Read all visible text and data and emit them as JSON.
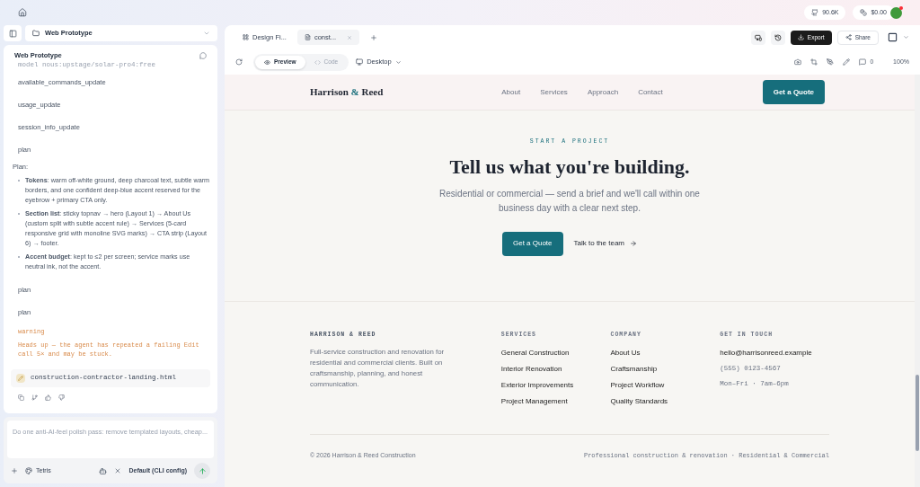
{
  "top_bar": {
    "stars": "90.6K",
    "cost": "$0.00"
  },
  "project": {
    "name": "Web Prototype"
  },
  "chat": {
    "title": "Web Prototype",
    "events": [
      {
        "kind": "mono",
        "text": "model nous:upstage/solar-pro4:free"
      },
      {
        "kind": "event",
        "text": "available_commands_update"
      },
      {
        "kind": "event",
        "text": "usage_update"
      },
      {
        "kind": "event",
        "text": "session_info_update"
      },
      {
        "kind": "event",
        "text": "plan"
      }
    ],
    "plan_heading": "Plan:",
    "plan_items": [
      {
        "text": "**Tokens**: warm off-white ground, deep charcoal text, subtle warm borders, and one confident deep-blue accent reserved for the eyebrow + primary CTA only."
      },
      {
        "text": "**Section list**: sticky topnav → hero (Layout 1) → About Us (custom split with subtle accent rule) → Services (5-card responsive grid with monoline SVG marks) → CTA strip (Layout 6) → footer."
      },
      {
        "text": "**Accent budget**: kept to ≤2 per screen; service marks use neutral ink, not the accent."
      }
    ],
    "after": [
      {
        "kind": "event",
        "text": "plan"
      },
      {
        "kind": "event",
        "text": "plan"
      }
    ],
    "warning": {
      "label": "warning",
      "text": "Heads up — the agent has repeated a failing Edit call 5× and may be stuck."
    },
    "file": "construction-contractor-landing.html"
  },
  "composer": {
    "placeholder": "Do one anti-AI-feel polish pass: remove templated layouts, cheap...",
    "skill": "Tetris",
    "model": "Default (CLI config)"
  },
  "tabs": [
    {
      "label": "Design Fi...",
      "selected": false
    },
    {
      "label": "const...",
      "selected": true
    }
  ],
  "actions": {
    "export": "Export",
    "share": "Share"
  },
  "toolbar": {
    "modes": [
      {
        "label": "Preview",
        "selected": true
      },
      {
        "label": "Code",
        "selected": false
      }
    ],
    "device": "Desktop",
    "comments": "0",
    "zoom": "100%"
  },
  "site": {
    "logo_a": "Harrison",
    "logo_amp": "&",
    "logo_b": "Reed",
    "nav": [
      "About",
      "Services",
      "Approach",
      "Contact"
    ],
    "nav_cta": "Get a Quote",
    "eyebrow": "START A PROJECT",
    "headline": "Tell us what you're building.",
    "sub": "Residential or commercial — send a brief and we'll call within one business day with a clear next step.",
    "cta_primary": "Get a Quote",
    "cta_secondary": "Talk to the team",
    "footer": {
      "brand": "HARRISON & REED",
      "about": "Full-service construction and renovation for residential and commercial clients. Built on craftsmanship, planning, and honest communication.",
      "columns": [
        {
          "title": "SERVICES",
          "links": [
            {
              "kind": "link",
              "text": "General Construction"
            },
            {
              "kind": "link",
              "text": "Interior Renovation"
            },
            {
              "kind": "link",
              "text": "Exterior Improvements"
            },
            {
              "kind": "link",
              "text": "Project Management"
            }
          ]
        },
        {
          "title": "COMPANY",
          "links": [
            {
              "kind": "link",
              "text": "About Us"
            },
            {
              "kind": "link",
              "text": "Craftsmanship"
            },
            {
              "kind": "link",
              "text": "Project Workflow"
            },
            {
              "kind": "link",
              "text": "Quality Standards"
            }
          ]
        },
        {
          "title": "GET IN TOUCH",
          "links": [
            {
              "kind": "link",
              "text": "hello@harrisonreed.example"
            },
            {
              "kind": "mono",
              "text": "(555) 0123-4567"
            },
            {
              "kind": "mono",
              "text": "Mon–Fri · 7am–6pm"
            }
          ]
        }
      ],
      "copyright": "© 2026 Harrison & Reed Construction",
      "tagline": "Professional construction & renovation · Residential & Commercial"
    }
  }
}
